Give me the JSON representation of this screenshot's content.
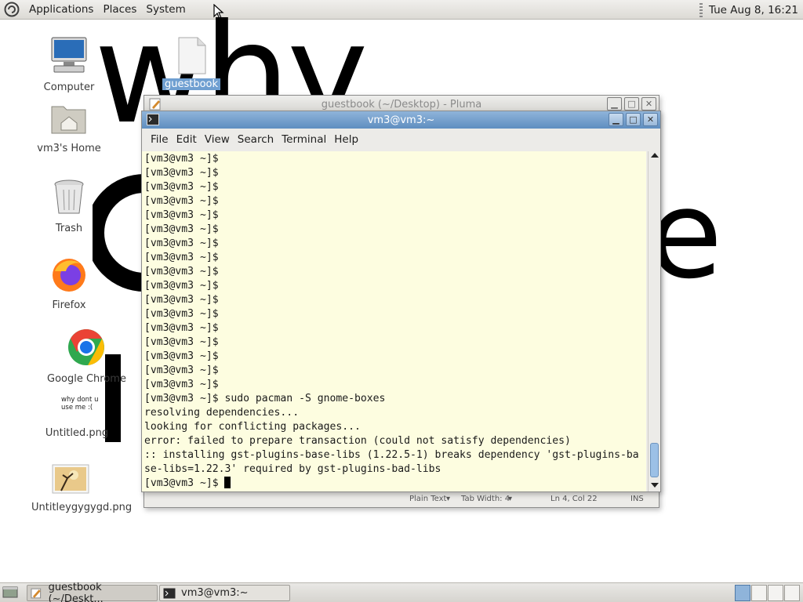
{
  "top_panel": {
    "menus": [
      "Applications",
      "Places",
      "System"
    ],
    "clock": "Tue Aug  8, 16:21"
  },
  "desktop_icons": [
    {
      "label": "Computer",
      "icon": "computer-icon"
    },
    {
      "label": "guestbook",
      "icon": "text-file-icon"
    },
    {
      "label": "vm3's Home",
      "icon": "home-folder-icon"
    },
    {
      "label": "Trash",
      "icon": "trash-icon"
    },
    {
      "label": "Firefox",
      "icon": "firefox-icon"
    },
    {
      "label": "Google Chrome",
      "icon": "chrome-icon"
    },
    {
      "label": "Untitled.png",
      "icon": "image-icon",
      "thumb_text": "why dont u use me :("
    },
    {
      "label": "Untitleygygygd.png",
      "icon": "image-icon"
    }
  ],
  "background_text": {
    "word1": "why",
    "word2": "e"
  },
  "pluma_window": {
    "title": "guestbook (~/Desktop) - Pluma",
    "status": {
      "syntax": "Plain Text",
      "tab_width": "Tab Width:  4",
      "position": "Ln 4, Col 22",
      "mode": "INS"
    }
  },
  "terminal_window": {
    "title": "vm3@vm3:~",
    "menus": [
      "File",
      "Edit",
      "View",
      "Search",
      "Terminal",
      "Help"
    ],
    "lines": [
      "[vm3@vm3 ~]$",
      "[vm3@vm3 ~]$",
      "[vm3@vm3 ~]$",
      "[vm3@vm3 ~]$",
      "[vm3@vm3 ~]$",
      "[vm3@vm3 ~]$",
      "[vm3@vm3 ~]$",
      "[vm3@vm3 ~]$",
      "[vm3@vm3 ~]$",
      "[vm3@vm3 ~]$",
      "[vm3@vm3 ~]$",
      "[vm3@vm3 ~]$",
      "[vm3@vm3 ~]$",
      "[vm3@vm3 ~]$",
      "[vm3@vm3 ~]$",
      "[vm3@vm3 ~]$",
      "[vm3@vm3 ~]$",
      "[vm3@vm3 ~]$ sudo pacman -S gnome-boxes",
      "resolving dependencies...",
      "looking for conflicting packages...",
      "error: failed to prepare transaction (could not satisfy dependencies)",
      ":: installing gst-plugins-base-libs (1.22.5-1) breaks dependency 'gst-plugins-ba",
      "se-libs=1.22.3' required by gst-plugins-bad-libs",
      "[vm3@vm3 ~]$ "
    ]
  },
  "taskbar": {
    "tasks": [
      "guestbook (~/Deskt...",
      "vm3@vm3:~"
    ]
  }
}
